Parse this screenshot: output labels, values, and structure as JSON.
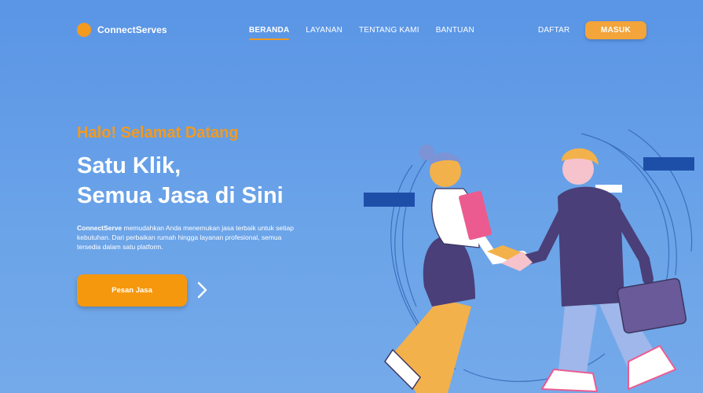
{
  "brand": {
    "name": "ConnectServes",
    "accent": "#f39a1f"
  },
  "nav": {
    "items": [
      {
        "label": "BERANDA",
        "active": true
      },
      {
        "label": "LAYANAN",
        "active": false
      },
      {
        "label": "TENTANG KAMI",
        "active": false
      },
      {
        "label": "BANTUAN",
        "active": false
      }
    ],
    "register_label": "DAFTAR",
    "login_label": "MASUK"
  },
  "hero": {
    "greeting": "Halo! Selamat Datang",
    "headline_line1": "Satu Klik,",
    "headline_line2": "Semua Jasa di Sini",
    "description_bold": "ConnectServe",
    "description_rest": " memudahkan Anda menemukan jasa terbaik untuk setiap kebutuhan. Dari perbaikan rumah hingga layanan profesional, semua tersedia dalam satu platform.",
    "cta_label": "Pesan Jasa"
  },
  "colors": {
    "background": "#5f99e6",
    "accent_orange": "#f39a1f",
    "button_orange": "#f6980d",
    "illustration_navy": "#1e4fa8",
    "illustration_purple": "#4a3f78",
    "illustration_pink": "#ec5b8f"
  },
  "illustration": {
    "icon": "handshake-illustration"
  }
}
